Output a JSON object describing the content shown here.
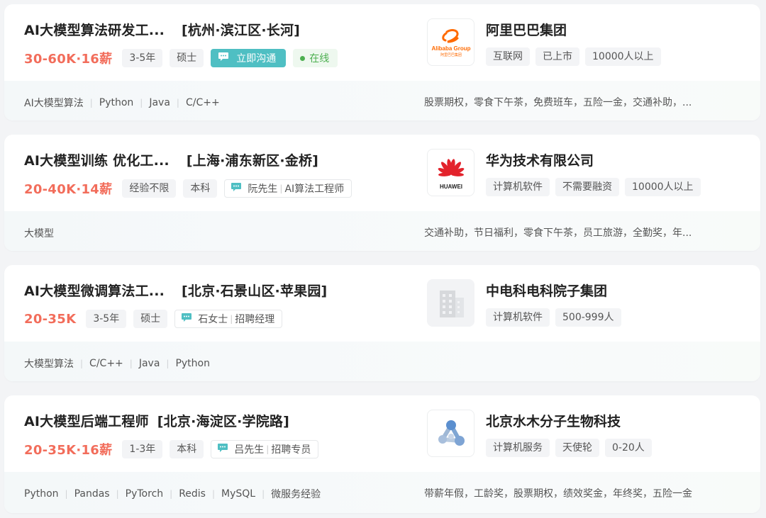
{
  "jobs": [
    {
      "title": "AI大模型算法研发工...",
      "location": "[杭州·滨江区·长河]",
      "salary": "30-60K·16薪",
      "tags": [
        "3-5年",
        "硕士"
      ],
      "chat_button": "立即沟通",
      "online": "在线",
      "company": "阿里巴巴集团",
      "company_tags": [
        "互联网",
        "已上市",
        "10000人以上"
      ],
      "skills": [
        "AI大模型算法",
        "Python",
        "Java",
        "C/C++"
      ],
      "benefits": "股票期权，零食下午茶，免费班车，五险一金，交通补助，...",
      "logo": "alibaba-logo",
      "logo_text": "Alibaba Group",
      "logo_subtext": "阿里巴巴集团"
    },
    {
      "title": "AI大模型训练 优化工...",
      "location": "[上海·浦东新区·金桥]",
      "salary": "20-40K·14薪",
      "tags": [
        "经验不限",
        "本科"
      ],
      "recruiter_name": "阮先生",
      "recruiter_role": "AI算法工程师",
      "company": "华为技术有限公司",
      "company_tags": [
        "计算机软件",
        "不需要融资",
        "10000人以上"
      ],
      "skills": [
        "大模型"
      ],
      "benefits": "交通补助，节日福利，零食下午茶，员工旅游，全勤奖，年...",
      "logo": "huawei-logo",
      "logo_text": "HUAWEI"
    },
    {
      "title": "AI大模型微调算法工...",
      "location": "[北京·石景山区·苹果园]",
      "salary": "20-35K",
      "tags": [
        "3-5年",
        "硕士"
      ],
      "recruiter_name": "石女士",
      "recruiter_role": "招聘经理",
      "company": "中电科电科院子集团",
      "company_tags": [
        "计算机软件",
        "500-999人"
      ],
      "skills": [
        "大模型算法",
        "C/C++",
        "Java",
        "Python"
      ],
      "benefits": "",
      "logo": "building-icon"
    },
    {
      "title": "AI大模型后端工程师",
      "location": "[北京·海淀区·学院路]",
      "salary": "20-35K·16薪",
      "tags": [
        "1-3年",
        "本科"
      ],
      "recruiter_name": "吕先生",
      "recruiter_role": "招聘专员",
      "company": "北京水木分子生物科技",
      "company_tags": [
        "计算机服务",
        "天使轮",
        "0-20人"
      ],
      "skills": [
        "Python",
        "Pandas",
        "PyTorch",
        "Redis",
        "MySQL",
        "微服务经验"
      ],
      "benefits": "带薪年假，工龄奖，股票期权，绩效奖金，年终奖，五险一金",
      "logo": "molecule-logo"
    }
  ],
  "colors": {
    "salary": "#f26d5b",
    "accent_teal": "#4fbfc3",
    "online_green": "#4caf50",
    "huawei_red": "#e3232c",
    "alibaba_orange": "#ff6a00"
  }
}
